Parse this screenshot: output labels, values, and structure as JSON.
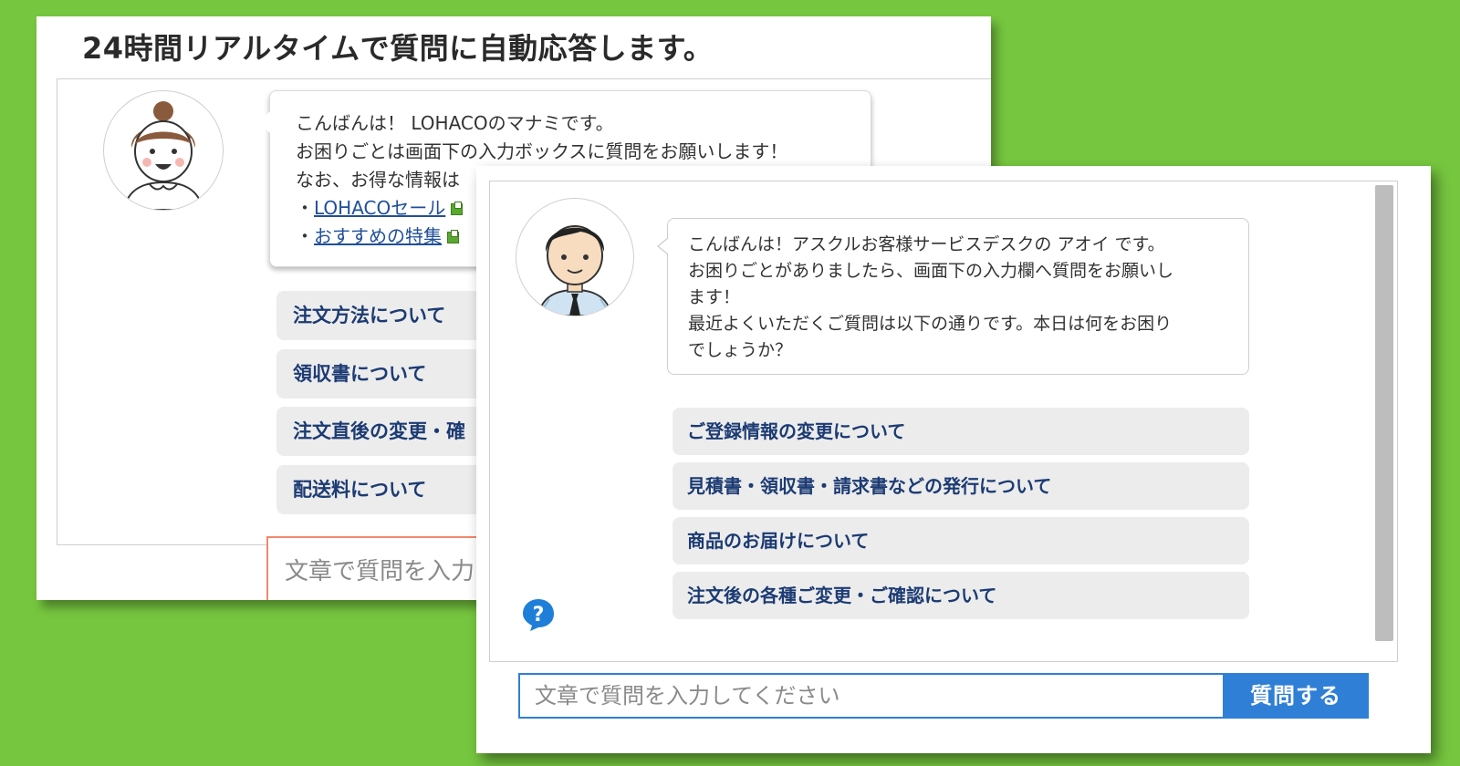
{
  "colors": {
    "background": "#76c63f",
    "option_text": "#1c3b73",
    "primary_button": "#2f7fd6",
    "back_input_border": "#f0896d"
  },
  "back_window": {
    "title": "24時間リアルタイムで質問に自動応答します。",
    "avatar_icon": "female-operator-avatar",
    "bubble": {
      "line1": "こんばんは！ LOHACOのマナミです。",
      "line2": "お困りごとは画面下の入力ボックスに質問をお願いします！",
      "line3": "なお、お得な情報は",
      "bullet": "・",
      "link1": "LOHACOセール",
      "link2": "おすすめの特集",
      "link_icon": "external-link-icon"
    },
    "options": [
      "注文方法について",
      "領収書について",
      "注文直後の変更・確",
      "配送料について"
    ],
    "input_placeholder": "文章で質問を入力"
  },
  "front_window": {
    "avatar_icon": "male-operator-avatar",
    "bubble": {
      "line1": "こんばんは！アスクルお客様サービスデスクの アオイ です。",
      "line2": "お困りごとがありましたら、画面下の入力欄へ質問をお願いし",
      "line3": "ます！",
      "line4": "最近よくいただくご質問は以下の通りです。本日は何をお困り",
      "line5": "でしょうか？"
    },
    "options": [
      "ご登録情報の変更について",
      "見積書・領収書・請求書などの発行について",
      "商品のお届けについて",
      "注文後の各種ご変更・ご確認について"
    ],
    "help_icon": "help-question-icon",
    "input_placeholder": "文章で質問を入力してください",
    "send_label": "質問する"
  }
}
